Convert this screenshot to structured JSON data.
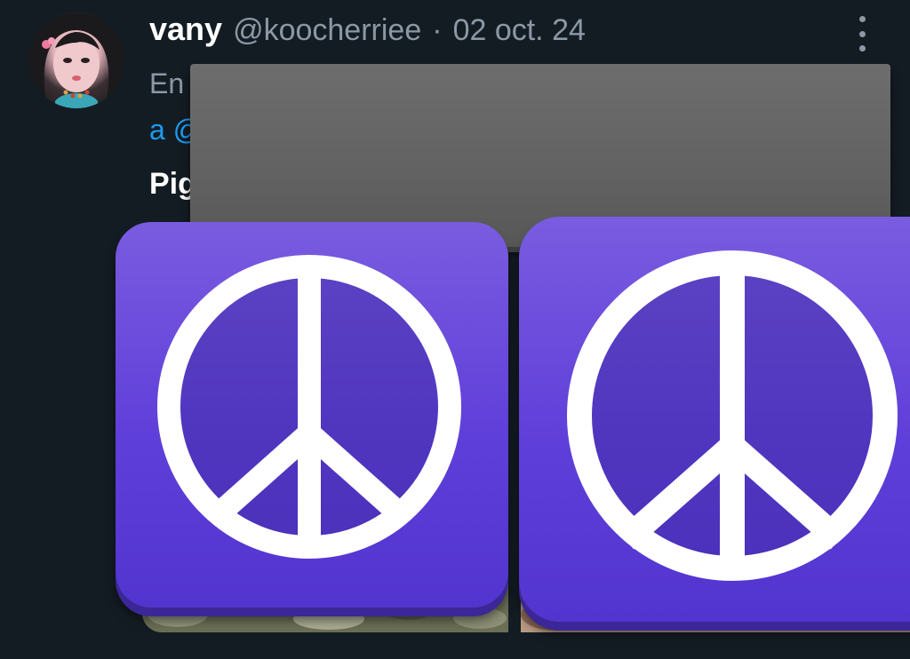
{
  "post": {
    "author_name": "vany",
    "author_handle": "@koocherriee",
    "separator": "·",
    "date": "02 oct. 24",
    "context_fragment": "En",
    "mention_fragment": "a @",
    "text_fragment": "Pig"
  },
  "icons": {
    "more": "more-vertical-icon",
    "peace": "peace-sign-icon"
  },
  "colors": {
    "background": "#141c23",
    "name": "#ffffff",
    "secondary": "#8b98a5",
    "mention": "#1d9bf0",
    "peace_tile": "#6a4ddc",
    "redaction": "#656565"
  }
}
